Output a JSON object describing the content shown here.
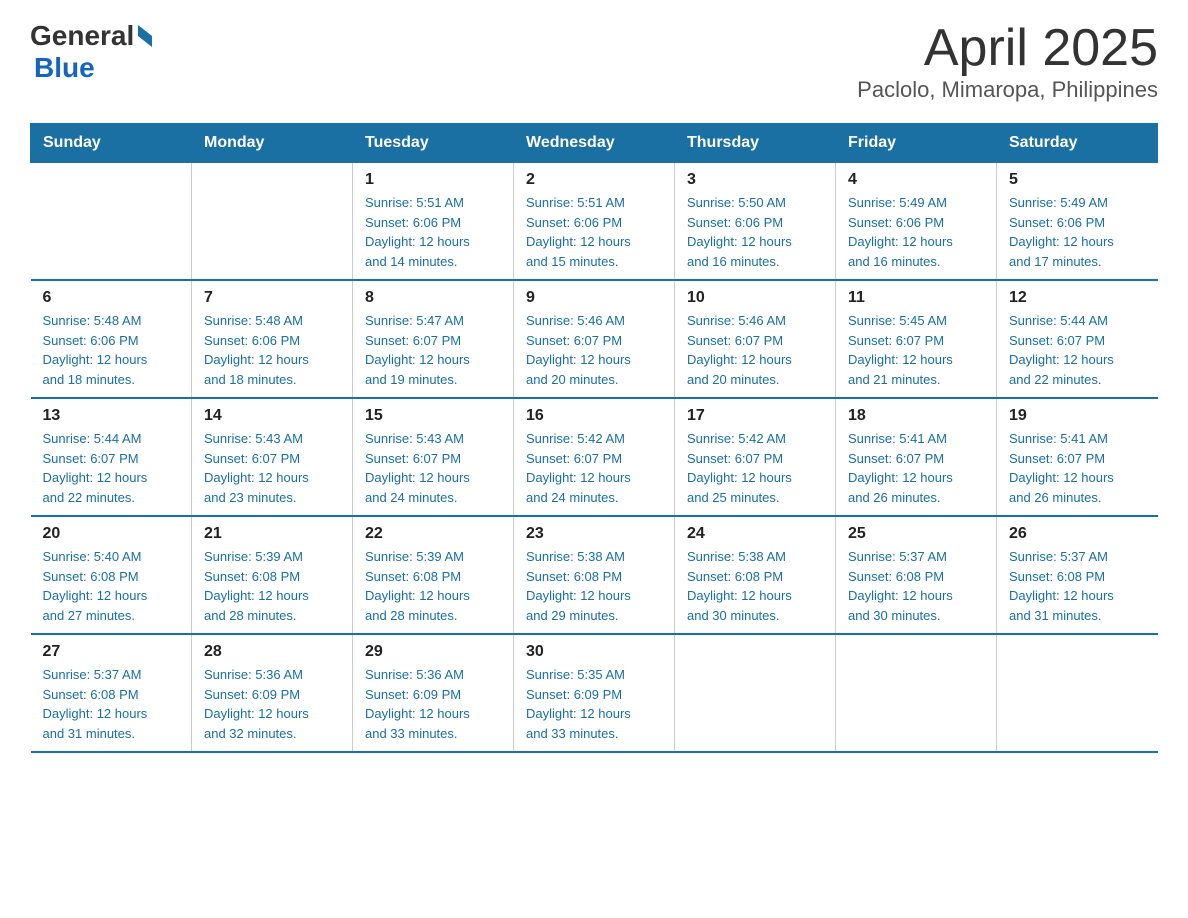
{
  "logo": {
    "general": "General",
    "blue": "Blue"
  },
  "title": "April 2025",
  "subtitle": "Paclolo, Mimaropa, Philippines",
  "header_days": [
    "Sunday",
    "Monday",
    "Tuesday",
    "Wednesday",
    "Thursday",
    "Friday",
    "Saturday"
  ],
  "weeks": [
    [
      {
        "day": "",
        "info": ""
      },
      {
        "day": "",
        "info": ""
      },
      {
        "day": "1",
        "info": "Sunrise: 5:51 AM\nSunset: 6:06 PM\nDaylight: 12 hours\nand 14 minutes."
      },
      {
        "day": "2",
        "info": "Sunrise: 5:51 AM\nSunset: 6:06 PM\nDaylight: 12 hours\nand 15 minutes."
      },
      {
        "day": "3",
        "info": "Sunrise: 5:50 AM\nSunset: 6:06 PM\nDaylight: 12 hours\nand 16 minutes."
      },
      {
        "day": "4",
        "info": "Sunrise: 5:49 AM\nSunset: 6:06 PM\nDaylight: 12 hours\nand 16 minutes."
      },
      {
        "day": "5",
        "info": "Sunrise: 5:49 AM\nSunset: 6:06 PM\nDaylight: 12 hours\nand 17 minutes."
      }
    ],
    [
      {
        "day": "6",
        "info": "Sunrise: 5:48 AM\nSunset: 6:06 PM\nDaylight: 12 hours\nand 18 minutes."
      },
      {
        "day": "7",
        "info": "Sunrise: 5:48 AM\nSunset: 6:06 PM\nDaylight: 12 hours\nand 18 minutes."
      },
      {
        "day": "8",
        "info": "Sunrise: 5:47 AM\nSunset: 6:07 PM\nDaylight: 12 hours\nand 19 minutes."
      },
      {
        "day": "9",
        "info": "Sunrise: 5:46 AM\nSunset: 6:07 PM\nDaylight: 12 hours\nand 20 minutes."
      },
      {
        "day": "10",
        "info": "Sunrise: 5:46 AM\nSunset: 6:07 PM\nDaylight: 12 hours\nand 20 minutes."
      },
      {
        "day": "11",
        "info": "Sunrise: 5:45 AM\nSunset: 6:07 PM\nDaylight: 12 hours\nand 21 minutes."
      },
      {
        "day": "12",
        "info": "Sunrise: 5:44 AM\nSunset: 6:07 PM\nDaylight: 12 hours\nand 22 minutes."
      }
    ],
    [
      {
        "day": "13",
        "info": "Sunrise: 5:44 AM\nSunset: 6:07 PM\nDaylight: 12 hours\nand 22 minutes."
      },
      {
        "day": "14",
        "info": "Sunrise: 5:43 AM\nSunset: 6:07 PM\nDaylight: 12 hours\nand 23 minutes."
      },
      {
        "day": "15",
        "info": "Sunrise: 5:43 AM\nSunset: 6:07 PM\nDaylight: 12 hours\nand 24 minutes."
      },
      {
        "day": "16",
        "info": "Sunrise: 5:42 AM\nSunset: 6:07 PM\nDaylight: 12 hours\nand 24 minutes."
      },
      {
        "day": "17",
        "info": "Sunrise: 5:42 AM\nSunset: 6:07 PM\nDaylight: 12 hours\nand 25 minutes."
      },
      {
        "day": "18",
        "info": "Sunrise: 5:41 AM\nSunset: 6:07 PM\nDaylight: 12 hours\nand 26 minutes."
      },
      {
        "day": "19",
        "info": "Sunrise: 5:41 AM\nSunset: 6:07 PM\nDaylight: 12 hours\nand 26 minutes."
      }
    ],
    [
      {
        "day": "20",
        "info": "Sunrise: 5:40 AM\nSunset: 6:08 PM\nDaylight: 12 hours\nand 27 minutes."
      },
      {
        "day": "21",
        "info": "Sunrise: 5:39 AM\nSunset: 6:08 PM\nDaylight: 12 hours\nand 28 minutes."
      },
      {
        "day": "22",
        "info": "Sunrise: 5:39 AM\nSunset: 6:08 PM\nDaylight: 12 hours\nand 28 minutes."
      },
      {
        "day": "23",
        "info": "Sunrise: 5:38 AM\nSunset: 6:08 PM\nDaylight: 12 hours\nand 29 minutes."
      },
      {
        "day": "24",
        "info": "Sunrise: 5:38 AM\nSunset: 6:08 PM\nDaylight: 12 hours\nand 30 minutes."
      },
      {
        "day": "25",
        "info": "Sunrise: 5:37 AM\nSunset: 6:08 PM\nDaylight: 12 hours\nand 30 minutes."
      },
      {
        "day": "26",
        "info": "Sunrise: 5:37 AM\nSunset: 6:08 PM\nDaylight: 12 hours\nand 31 minutes."
      }
    ],
    [
      {
        "day": "27",
        "info": "Sunrise: 5:37 AM\nSunset: 6:08 PM\nDaylight: 12 hours\nand 31 minutes."
      },
      {
        "day": "28",
        "info": "Sunrise: 5:36 AM\nSunset: 6:09 PM\nDaylight: 12 hours\nand 32 minutes."
      },
      {
        "day": "29",
        "info": "Sunrise: 5:36 AM\nSunset: 6:09 PM\nDaylight: 12 hours\nand 33 minutes."
      },
      {
        "day": "30",
        "info": "Sunrise: 5:35 AM\nSunset: 6:09 PM\nDaylight: 12 hours\nand 33 minutes."
      },
      {
        "day": "",
        "info": ""
      },
      {
        "day": "",
        "info": ""
      },
      {
        "day": "",
        "info": ""
      }
    ]
  ]
}
